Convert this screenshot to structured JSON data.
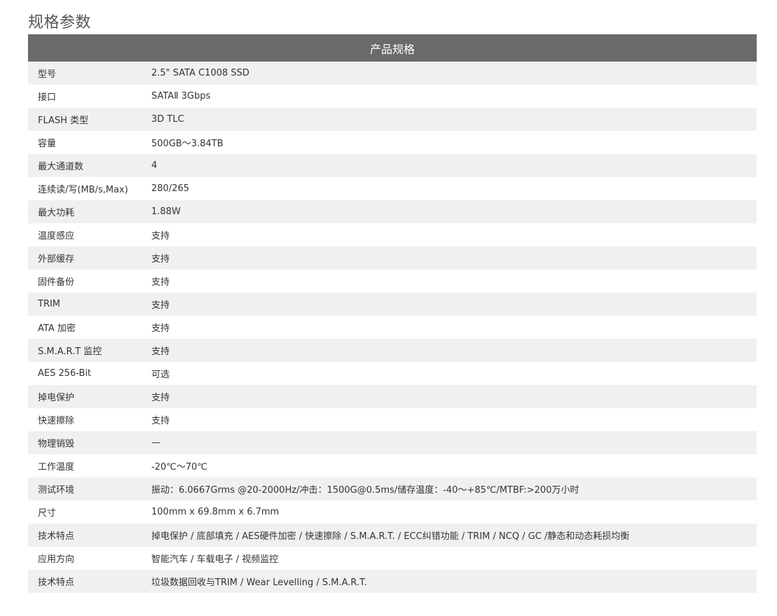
{
  "page": {
    "title": "规格参数"
  },
  "table": {
    "header": "产品规格",
    "rows": [
      {
        "label": "型号",
        "value": "2.5\" SATA C1008 SSD"
      },
      {
        "label": "接口",
        "value": "SATAⅡ 3Gbps"
      },
      {
        "label": "FLASH 类型",
        "value": "3D TLC"
      },
      {
        "label": "容量",
        "value": "500GB～3.84TB"
      },
      {
        "label": "最大通道数",
        "value": "4"
      },
      {
        "label": "连续读/写(MB/s,Max)",
        "value": "280/265"
      },
      {
        "label": "最大功耗",
        "value": "1.88W"
      },
      {
        "label": "温度感应",
        "value": "支持"
      },
      {
        "label": "外部缓存",
        "value": "支持"
      },
      {
        "label": "固件备份",
        "value": "支持"
      },
      {
        "label": "TRIM",
        "value": "支持"
      },
      {
        "label": "ATA 加密",
        "value": "支持"
      },
      {
        "label": "S.M.A.R.T 监控",
        "value": "支持"
      },
      {
        "label": "AES 256-Bit",
        "value": "可选"
      },
      {
        "label": "掉电保护",
        "value": "支持"
      },
      {
        "label": "快速擦除",
        "value": "支持"
      },
      {
        "label": "物理销毁",
        "value": "—"
      },
      {
        "label": "工作温度",
        "value": "-20℃～70℃"
      },
      {
        "label": "测试环境",
        "value": "振动：6.0667Grms @20-2000Hz/冲击：1500G@0.5ms/储存温度：-40～+85℃/MTBF:>200万小时"
      },
      {
        "label": "尺寸",
        "value": "100mm x 69.8mm x 6.7mm"
      },
      {
        "label": "技术特点",
        "value": "掉电保护 / 底部填充 / AES硬件加密 / 快速擦除 / S.M.A.R.T. / ECC纠错功能 / TRIM / NCQ / GC /静态和动态耗损均衡"
      },
      {
        "label": "应用方向",
        "value": "智能汽车 / 车载电子 / 视频监控"
      },
      {
        "label": "技术特点",
        "value": "垃圾数据回收与TRIM / Wear Levelling / S.M.A.R.T."
      }
    ]
  }
}
